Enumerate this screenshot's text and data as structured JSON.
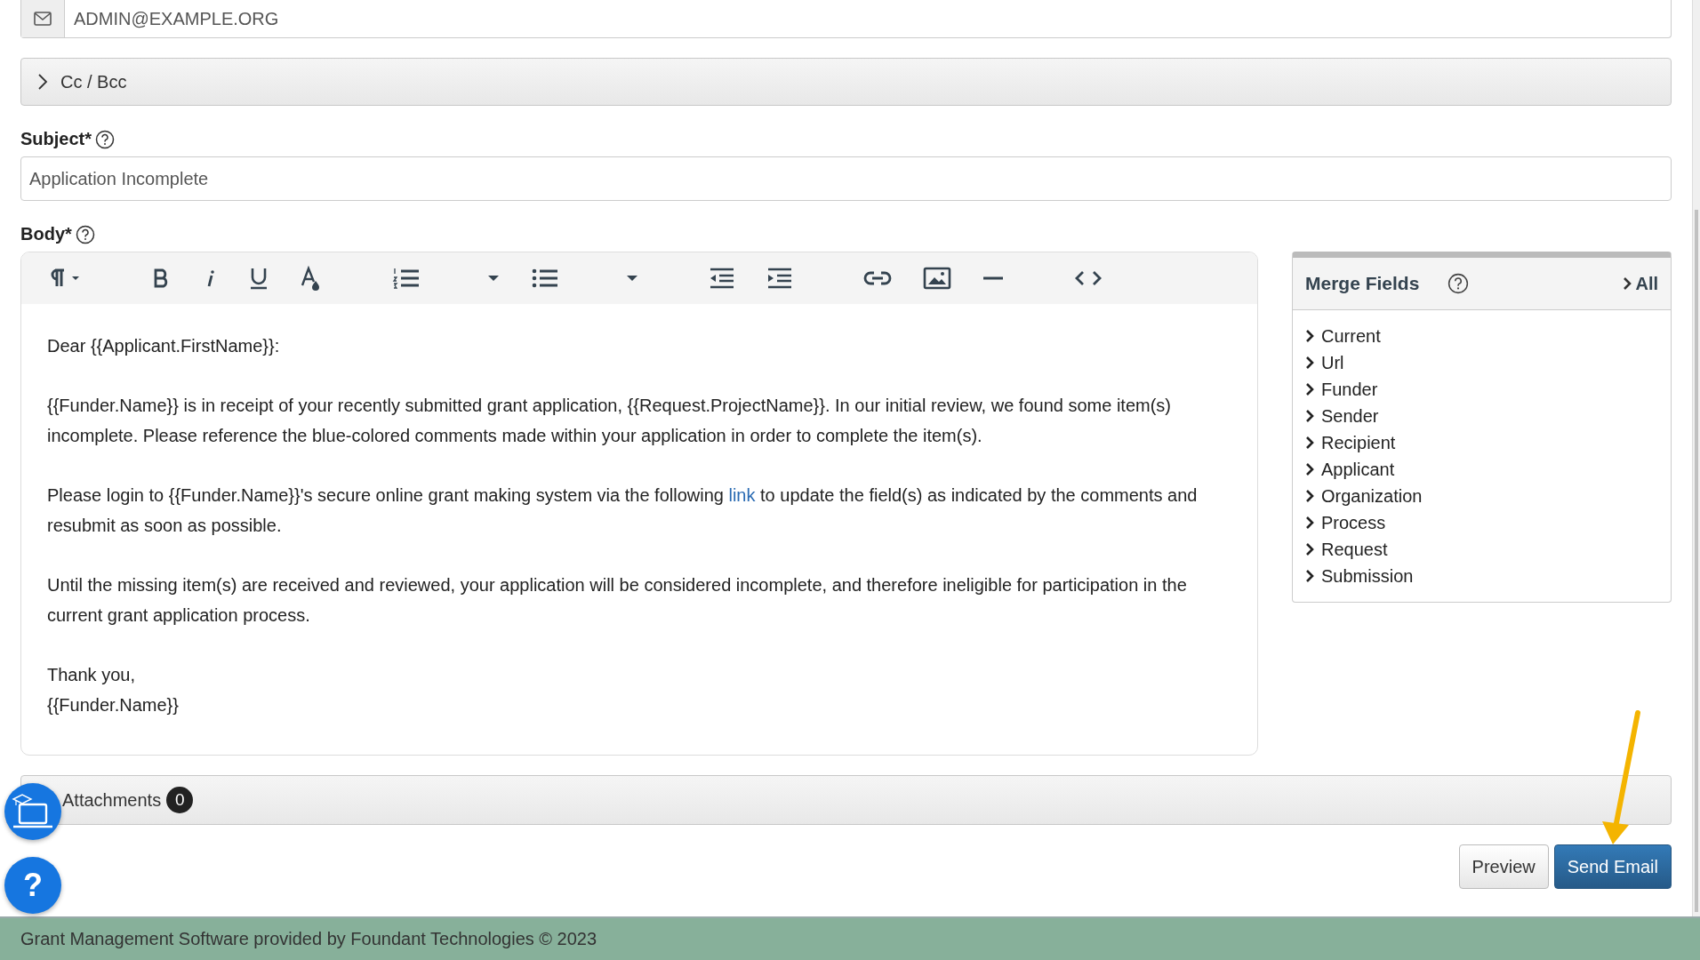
{
  "email_field": {
    "value": "ADMIN@EXAMPLE.ORG"
  },
  "cc_bcc": {
    "label": "Cc / Bcc",
    "expanded": false
  },
  "subject": {
    "label": "Subject*",
    "value": "Application Incomplete"
  },
  "body": {
    "label": "Body*",
    "paragraphs": [
      {
        "lines": [
          "Dear {{Applicant.FirstName}}:"
        ]
      },
      {
        "before": "{{Funder.Name}} is in receipt of your recently submitted grant application, {{Request.ProjectName}}. In our initial review, we found some item(s) incomplete. Please reference the blue-colored comments made within your application in order to complete the item(s)."
      },
      {
        "before": "Please login to {{Funder.Name}}'s secure online grant making system via the following ",
        "link": "link",
        "after": " to update the field(s) as indicated by the comments and resubmit as soon as possible."
      },
      {
        "before": "Until the missing item(s) are received and reviewed, your application will be considered incomplete, and therefore ineligible for participation in the current grant application process."
      },
      {
        "lines": [
          "Thank you,",
          "{{Funder.Name}}"
        ]
      }
    ]
  },
  "merge_fields": {
    "title": "Merge Fields",
    "all_link": "All",
    "items": [
      {
        "label": "Current",
        "expanded": false
      },
      {
        "label": "Url",
        "expanded": false
      },
      {
        "label": "Funder",
        "expanded": false
      },
      {
        "label": "Sender",
        "expanded": false
      },
      {
        "label": "Recipient",
        "expanded": false
      },
      {
        "label": "Applicant",
        "expanded": false
      },
      {
        "label": "Organization",
        "expanded": false
      },
      {
        "label": "Process",
        "expanded": false
      },
      {
        "label": "Request",
        "expanded": false
      },
      {
        "label": "Submission",
        "expanded": false
      }
    ]
  },
  "attachments": {
    "label": "Attachments",
    "count": "0"
  },
  "help_button": {
    "label": "?"
  },
  "buttons": [
    {
      "label": "Preview",
      "kind": "default"
    },
    {
      "label": "Send Email",
      "kind": "primary"
    }
  ],
  "footer": "Grant Management Software provided by Foundant Technologies © 2023"
}
